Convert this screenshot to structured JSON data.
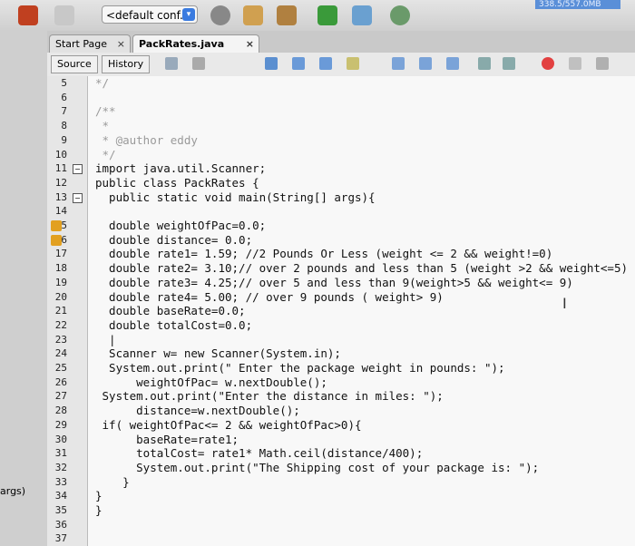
{
  "toolbar": {
    "config_label": "<default conf...",
    "memory_label": "338.5/557.0MB"
  },
  "tabs": [
    {
      "label": "Start Page"
    },
    {
      "label": "PackRates.java"
    }
  ],
  "editor_toolbar": {
    "source_label": "Source",
    "history_label": "History"
  },
  "left_panel": {
    "args_label": "args)"
  },
  "lines": [
    {
      "n": "5",
      "text": "*/"
    },
    {
      "n": "6",
      "text": ""
    },
    {
      "n": "7",
      "text": "/**"
    },
    {
      "n": "8",
      "text": " *"
    },
    {
      "n": "9",
      "text": " * @author eddy"
    },
    {
      "n": "10",
      "text": " */"
    },
    {
      "n": "11",
      "text": "import java.util.Scanner;"
    },
    {
      "n": "12",
      "text": "public class PackRates {"
    },
    {
      "n": "13",
      "text": "  public static void main(String[] args){"
    },
    {
      "n": "14",
      "text": ""
    },
    {
      "n": "15",
      "text": "  double weightOfPac=0.0;"
    },
    {
      "n": "16",
      "text": "  double distance= 0.0;"
    },
    {
      "n": "17",
      "text": "  double rate1= 1.59; //2 Pounds Or Less (weight <= 2 && weight!=0)"
    },
    {
      "n": "18",
      "text": "  double rate2= 3.10;// over 2 pounds and less than 5 (weight >2 && weight<=5)"
    },
    {
      "n": "19",
      "text": "  double rate3= 4.25;// over 5 and less than 9(weight>5 && weight<= 9)"
    },
    {
      "n": "20",
      "text": "  double rate4= 5.00; // over 9 pounds ( weight> 9)"
    },
    {
      "n": "21",
      "text": "  double baseRate=0.0;"
    },
    {
      "n": "22",
      "text": "  double totalCost=0.0;"
    },
    {
      "n": "23",
      "text": "  |"
    },
    {
      "n": "24",
      "text": "  Scanner w= new Scanner(System.in);"
    },
    {
      "n": "25",
      "text": "  System.out.print(\" Enter the package weight in pounds: \");"
    },
    {
      "n": "26",
      "text": "      weightOfPac= w.nextDouble();"
    },
    {
      "n": "27",
      "text": " System.out.print(\"Enter the distance in miles: \");"
    },
    {
      "n": "28",
      "text": "      distance=w.nextDouble();"
    },
    {
      "n": "29",
      "text": " if( weightOfPac<= 2 && weightOfPac>0){"
    },
    {
      "n": "30",
      "text": "      baseRate=rate1;"
    },
    {
      "n": "31",
      "text": "      totalCost= rate1* Math.ceil(distance/400);"
    },
    {
      "n": "32",
      "text": "      System.out.print(\"The Shipping cost of your package is: \");"
    },
    {
      "n": "33",
      "text": "    }"
    },
    {
      "n": "34",
      "text": "}"
    },
    {
      "n": "35",
      "text": "}"
    },
    {
      "n": "36",
      "text": ""
    },
    {
      "n": "37",
      "text": ""
    }
  ]
}
